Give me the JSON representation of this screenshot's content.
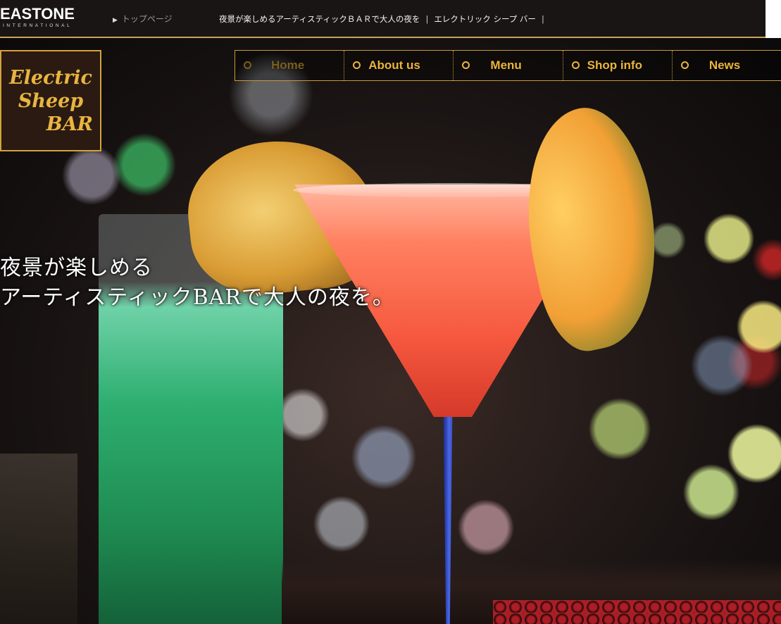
{
  "header": {
    "brand_name": "EASTONE",
    "brand_sub": "INTERNATIONAL",
    "breadcrumb": "トップページ",
    "tagline": "夜景が楽しめるアーティスティックＢＡＲで大人の夜を",
    "site_name": "エレクトリック シープ バー"
  },
  "logo": {
    "line1": "Electric",
    "line2": "Sheep",
    "line3": "BAR"
  },
  "nav": {
    "items": [
      {
        "label": "Home",
        "active": true
      },
      {
        "label": "About us"
      },
      {
        "label": "Menu"
      },
      {
        "label": "Shop info"
      },
      {
        "label": "News"
      }
    ]
  },
  "hero": {
    "line1": "夜景が楽しめる",
    "line2": "アーティスティックBARで大人の夜を。"
  },
  "colors": {
    "accent_gold": "#eab53a",
    "topbar_bg": "#1a1515"
  }
}
